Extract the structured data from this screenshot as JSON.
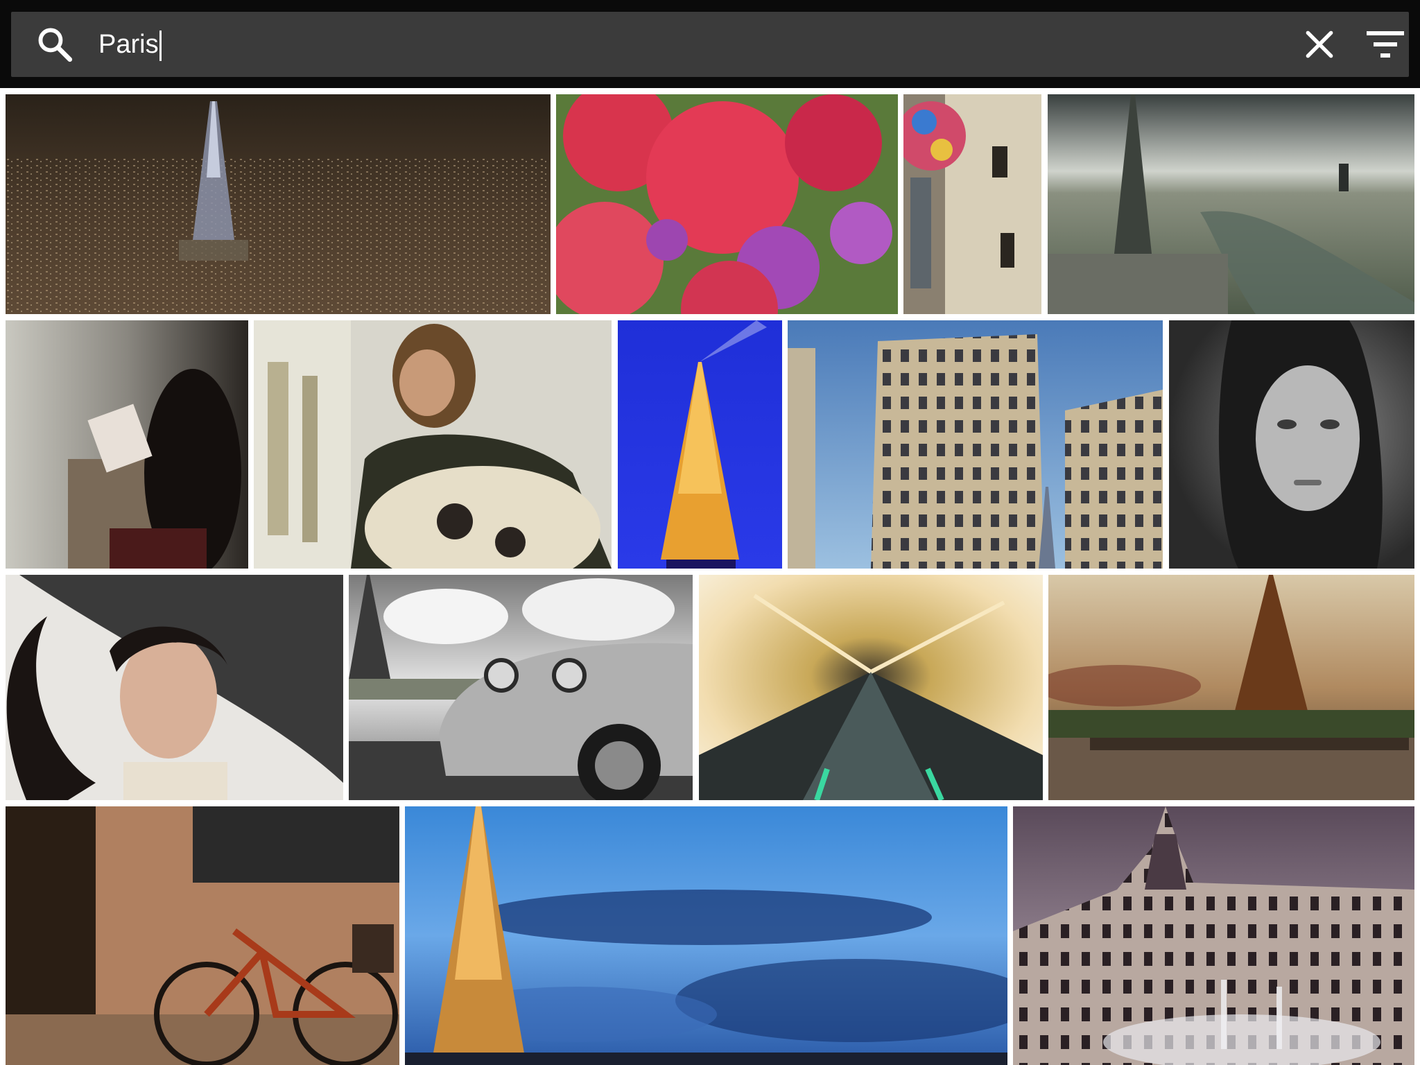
{
  "search": {
    "value": "Paris",
    "icons": {
      "search": "search-icon",
      "clear": "close-icon",
      "filter": "filter-icon"
    }
  },
  "colors": {
    "topbar": "#0a0a0a",
    "search_box": "#3b3b3b",
    "text": "#ffffff"
  },
  "photos": [
    {
      "subject": "eiffel-tower-night-city"
    },
    {
      "subject": "red-dahlias"
    },
    {
      "subject": "street-art-building"
    },
    {
      "subject": "notre-dame-aerial"
    },
    {
      "subject": "woman-reading-window"
    },
    {
      "subject": "woman-with-oud"
    },
    {
      "subject": "eiffel-tower-blue-night"
    },
    {
      "subject": "haussmann-building"
    },
    {
      "subject": "woman-portrait-bw"
    },
    {
      "subject": "woman-umbrella"
    },
    {
      "subject": "vintage-car-eiffel"
    },
    {
      "subject": "tunnel-motion-blur"
    },
    {
      "subject": "eiffel-tower-sunset-seine"
    },
    {
      "subject": "bicycle-wall"
    },
    {
      "subject": "eiffel-tower-blue-sky"
    },
    {
      "subject": "hotel-de-ville"
    }
  ]
}
